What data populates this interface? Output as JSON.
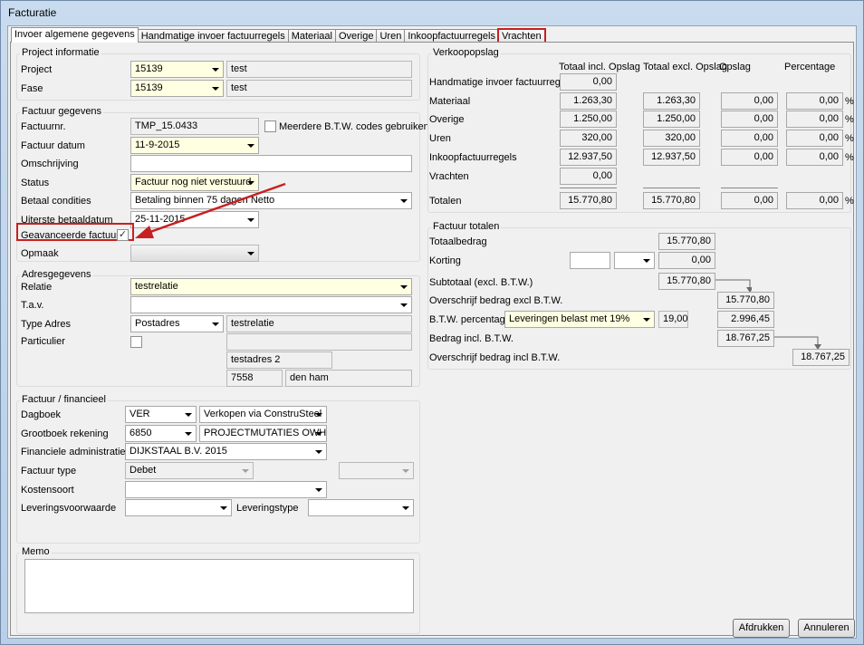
{
  "window": {
    "title": "Facturatie"
  },
  "tabs": [
    {
      "label": "Invoer algemene gegevens"
    },
    {
      "label": "Handmatige invoer factuurregels"
    },
    {
      "label": "Materiaal"
    },
    {
      "label": "Overige"
    },
    {
      "label": "Uren"
    },
    {
      "label": "Inkoopfactuurregels"
    },
    {
      "label": "Vrachten"
    }
  ],
  "project": {
    "title": "Project informatie",
    "project_label": "Project",
    "project_value": "15139",
    "project_name": "test",
    "fase_label": "Fase",
    "fase_value": "15139",
    "fase_name": "test"
  },
  "factuur": {
    "title": "Factuur gegevens",
    "nr_label": "Factuurnr.",
    "nr_value": "TMP_15.0433",
    "meerdere_label": "Meerdere B.T.W. codes gebruiken",
    "meerdere_check": "",
    "datum_label": "Factuur datum",
    "datum_value": "11-9-2015",
    "omschrijving_label": "Omschrijving",
    "omschrijving_value": "",
    "status_label": "Status",
    "status_value": "Factuur nog niet verstuurd",
    "betaal_label": "Betaal condities",
    "betaal_value": "Betaling binnen 75 dagen Netto",
    "uiterste_label": "Uiterste betaaldatum",
    "uiterste_value": "25-11-2015",
    "geavanceerd_label": "Geavanceerde factuur",
    "geavanceerd_check": "✓",
    "opmaak_label": "Opmaak",
    "opmaak_value": ""
  },
  "adres": {
    "title": "Adresgegevens",
    "relatie_label": "Relatie",
    "relatie_value": "testrelatie",
    "tav_label": "T.a.v.",
    "tav_value": "",
    "type_label": "Type Adres",
    "type_value": "Postadres",
    "naam": "testrelatie",
    "particulier_label": "Particulier",
    "particulier_check": "",
    "regel2": "",
    "adres": "testadres 2",
    "postcode": "7558",
    "plaats": "den ham"
  },
  "financieel": {
    "title": "Factuur / financieel",
    "dagboek_label": "Dagboek",
    "dagboek_code": "VER",
    "dagboek_name": "Verkopen via ConstruSteel",
    "grootboek_label": "Grootboek rekening",
    "grootboek_code": "6850",
    "grootboek_name": "PROJECTMUTATIES OWH CON",
    "admin_label": "Financiele administraties",
    "admin_value": "DIJKSTAAL B.V. 2015",
    "type_label": "Factuur type",
    "type_value": "Debet",
    "type_extra": "",
    "kostensoort_label": "Kostensoort",
    "kostensoort_value": "",
    "voorwaarde_label": "Leveringsvoorwaarde",
    "voorwaarde_value": "",
    "leveringstype_label": "Leveringstype",
    "leveringstype_value": ""
  },
  "memo": {
    "title": "Memo",
    "value": ""
  },
  "opslag": {
    "title": "Verkoopopslag",
    "headers": [
      "Totaal incl. Opslag",
      "Totaal excl. Opslag",
      "Opslag",
      "Percentage"
    ],
    "percent_sign": "%",
    "rows": [
      {
        "label": "Handmatige invoer factuurregels",
        "incl": "0,00"
      },
      {
        "label": "Materiaal",
        "incl": "1.263,30",
        "excl": "1.263,30",
        "opslag": "0,00",
        "pct": "0,00"
      },
      {
        "label": "Overige",
        "incl": "1.250,00",
        "excl": "1.250,00",
        "opslag": "0,00",
        "pct": "0,00"
      },
      {
        "label": "Uren",
        "incl": "320,00",
        "excl": "320,00",
        "opslag": "0,00",
        "pct": "0,00"
      },
      {
        "label": "Inkoopfactuurregels",
        "incl": "12.937,50",
        "excl": "12.937,50",
        "opslag": "0,00",
        "pct": "0,00"
      },
      {
        "label": "Vrachten",
        "incl": "0,00"
      },
      {
        "label": "Totalen",
        "incl": "15.770,80",
        "excl": "15.770,80",
        "opslag": "0,00",
        "pct": "0,00"
      }
    ]
  },
  "totalen": {
    "title": "Factuur totalen",
    "totaalbedrag_label": "Totaalbedrag",
    "totaalbedrag": "15.770,80",
    "korting_label": "Korting",
    "korting_input": "",
    "korting_type": "",
    "korting": "0,00",
    "subtotaal_label": "Subtotaal (excl. B.T.W.)",
    "subtotaal": "15.770,80",
    "overschrijf_excl_label": "Overschrijf bedrag excl B.T.W.",
    "overschrijf_excl": "15.770,80",
    "btw_label": "B.T.W. percentage",
    "btw_select": "Leveringen belast met 19%",
    "btw_pct": "19,00",
    "btw_bedrag": "2.996,45",
    "incl_label": "Bedrag incl. B.T.W.",
    "incl": "18.767,25",
    "overschrijf_incl_label": "Overschrijf bedrag incl B.T.W.",
    "overschrijf_incl": "18.767,25"
  },
  "buttons": {
    "print": "Afdrukken",
    "cancel": "Annuleren"
  },
  "colors": {
    "highlight": "#c82020",
    "required_field": "#ffffe1"
  }
}
